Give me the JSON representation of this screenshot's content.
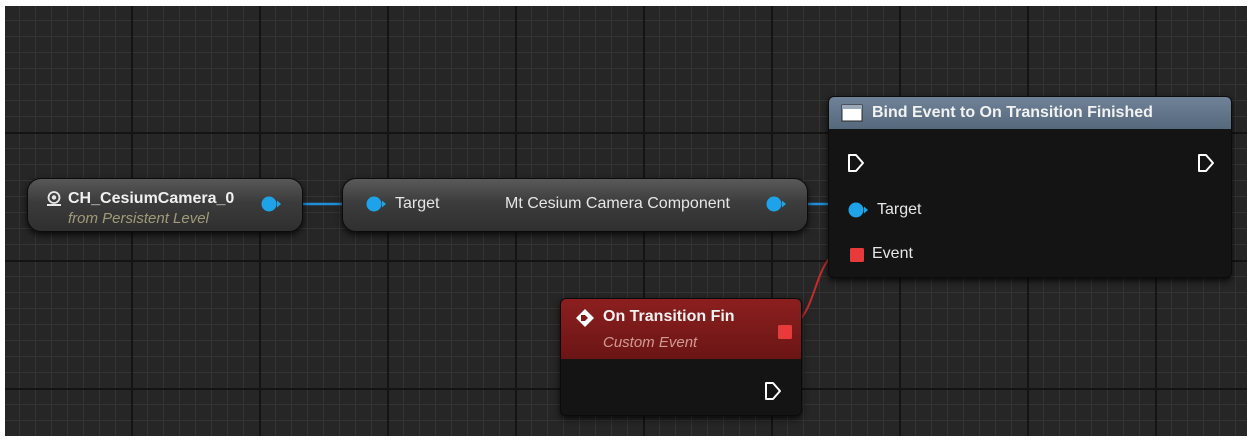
{
  "nodes": {
    "actor_reference": {
      "title": "CH_CesiumCamera_0",
      "subtitle": "from Persistent Level"
    },
    "component_getter": {
      "input_label": "Target",
      "output_label": "Mt Cesium Camera Component"
    },
    "bind_event": {
      "title": "Bind Event to On Transition Finished",
      "target_label": "Target",
      "event_label": "Event"
    },
    "custom_event": {
      "title": "On Transition Fin",
      "subtitle": "Custom Event"
    }
  },
  "colors": {
    "graph_background": "#262626",
    "object_pin": "#1fa3e8",
    "delegate_pin": "#e83a3a",
    "exec_pin": "#ffffff",
    "bind_header": "#5f7288",
    "event_header": "#7e1a1a"
  },
  "icons": {
    "actor": "actor-reference-icon",
    "bind_node": "function-node-icon",
    "custom_event": "event-diamond-icon"
  }
}
